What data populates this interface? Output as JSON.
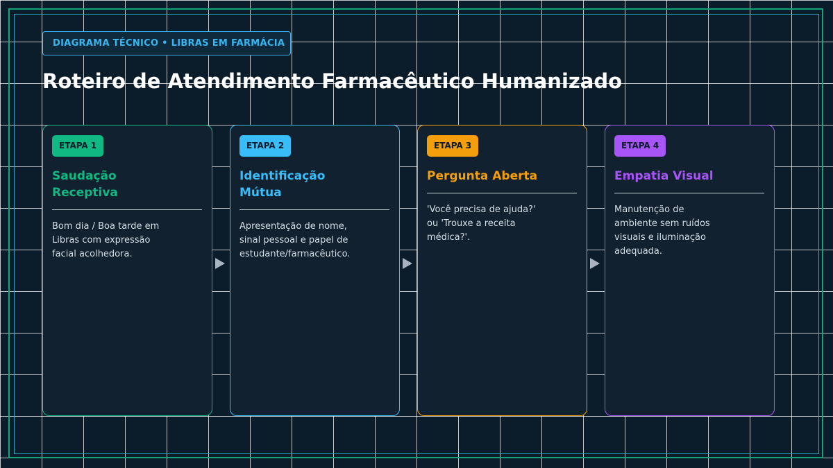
{
  "header": {
    "eyebrow": "DIAGRAMA TÉCNICO • LIBRAS EM FARMÁCIA",
    "title": "Roteiro de Atendimento Farmacêutico Humanizado"
  },
  "colors": {
    "background": "#0b1c2a",
    "card_background": "#11212f",
    "frame_outer": "#16a37a",
    "frame_inner": "#2aa4c0",
    "eyebrow_accent": "#38b6f0",
    "arrow": "#a9b4c0"
  },
  "steps": [
    {
      "badge": "ETAPA 1",
      "title": "Saudação Receptiva",
      "description": "Bom dia / Boa tarde em Libras com expressão facial acolhedora.",
      "color": "#10b981"
    },
    {
      "badge": "ETAPA 2",
      "title": "Identificação Mútua",
      "description": "Apresentação de nome, sinal pessoal e papel de estudante/farmacêutico.",
      "color": "#38bdf8"
    },
    {
      "badge": "ETAPA 3",
      "title": "Pergunta Aberta",
      "description": "'Você precisa de ajuda?' ou 'Trouxe a receita médica?'.",
      "color": "#f59e0b"
    },
    {
      "badge": "ETAPA 4",
      "title": "Empatia Visual",
      "description": "Manutenção de ambiente sem ruídos visuais e iluminação adequada.",
      "color": "#a855f7"
    }
  ],
  "connectors": [
    {
      "icon": "arrow-right-icon"
    },
    {
      "icon": "arrow-right-icon"
    },
    {
      "icon": "arrow-right-icon"
    }
  ]
}
